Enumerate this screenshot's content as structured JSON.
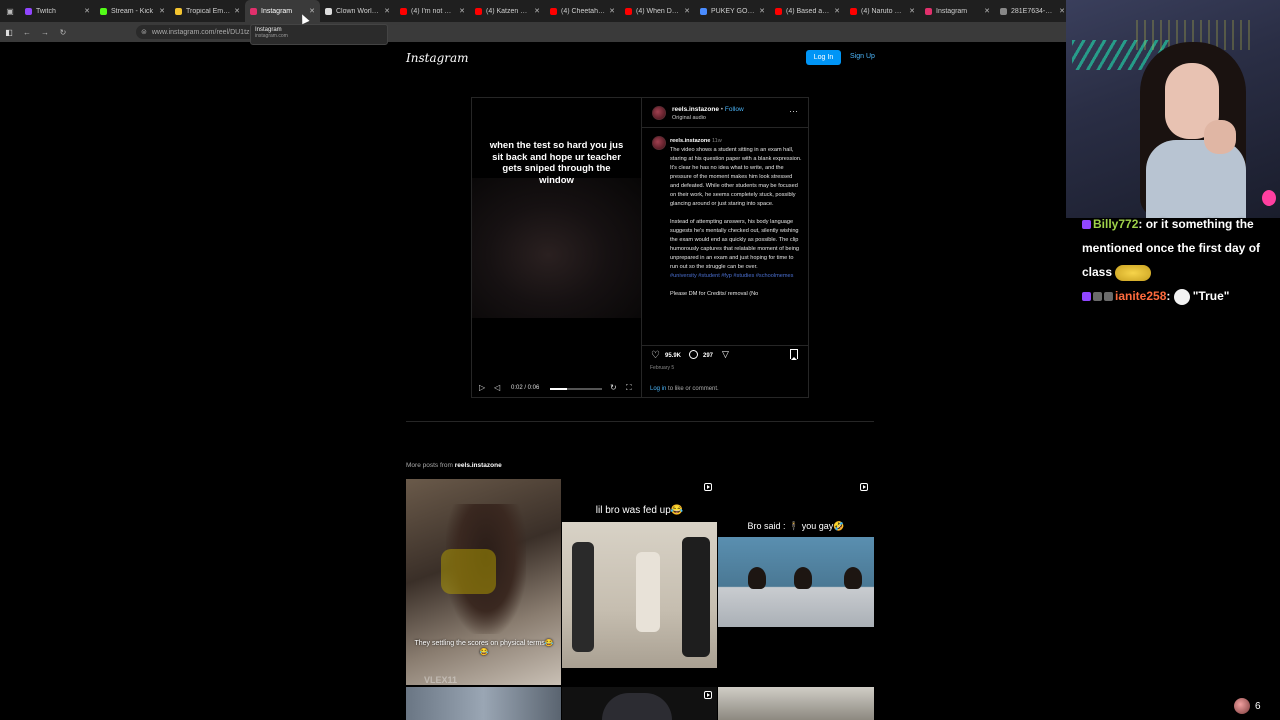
{
  "browser": {
    "tabs": [
      {
        "label": "Twitch",
        "color": "#9146ff"
      },
      {
        "label": "Stream - Kick",
        "color": "#53fc18"
      },
      {
        "label": "Tropical Emojis |",
        "color": "#f4c430"
      },
      {
        "label": "Instagram",
        "color": "#e1306c"
      },
      {
        "label": "Clown World ™",
        "color": "#dddddd"
      },
      {
        "label": "(4) I'm not better",
        "color": "#ff0000"
      },
      {
        "label": "(4) Katzen bringe",
        "color": "#ff0000"
      },
      {
        "label": "(4) Cheetahs Are",
        "color": "#ff0000"
      },
      {
        "label": "(4) When Dad Tr",
        "color": "#ff0000"
      },
      {
        "label": "PUKEY GODDES",
        "color": "#4a8cff"
      },
      {
        "label": "(4) Based anime",
        "color": "#ff0000"
      },
      {
        "label": "(4) Naruto LEGEN",
        "color": "#ff0000"
      },
      {
        "label": "Instagram",
        "color": "#e1306c"
      },
      {
        "label": "281E7634-91FC-4481",
        "color": "#888888"
      }
    ],
    "url": "www.instagram.com/reel/DU1tzu",
    "tooltip": {
      "title": "Instagram",
      "domain": "instagram.com"
    }
  },
  "instagram": {
    "logo": "Instagram",
    "login_label": "Log In",
    "signup_label": "Sign Up",
    "post": {
      "video_caption": "when the test so hard you jus sit back and hope ur teacher gets sniped through the window",
      "video_time": "0:02 / 0:06",
      "video_progress": 0.33,
      "username": "reels.instazone",
      "dot": "•",
      "follow_label": "Follow",
      "audio": "Original audio",
      "comment_user": "reels.instazone",
      "comment_ago": "11w",
      "paragraph1": "The video shows a student sitting in an exam hall, staring at his question paper with a blank expression. It's clear he has no idea what to write, and the pressure of the moment makes him look stressed and defeated. While other students may be focused on their work, he seems completely stuck, possibly glancing around or just staring into space.",
      "paragraph2": "Instead of attempting answers, his body language suggests he's mentally checked out, silently wishing the exam would end as quickly as possible. The clip humorously captures that relatable moment of being unprepared in an exam and just hoping for time to run out so the struggle can be over.",
      "hashtags": "#university #student #fyp #studies #schoolmemes",
      "paragraph3": "Please DM for Credits/ removal (No",
      "likes": "95.9K",
      "comments": "297",
      "date": "February 5",
      "login_prompt_link": "Log in",
      "login_prompt_rest": " to like or comment."
    },
    "more_posts": {
      "prefix": "More posts from ",
      "username": "reels.instazone",
      "items": [
        {
          "caption": "They settling the scores on physical terms😂😂",
          "watermark": "VLEX11"
        },
        {
          "caption": "lil bro was fed up😂"
        },
        {
          "caption": "Bro said : 🕴 you gay🤣"
        }
      ]
    }
  },
  "stream": {
    "chat": [
      {
        "user": "Billy772",
        "message": " or it something the mentioned once the first day of class"
      },
      {
        "user": "ianite258",
        "message": "\"True\""
      }
    ],
    "viewer_count": "6"
  }
}
